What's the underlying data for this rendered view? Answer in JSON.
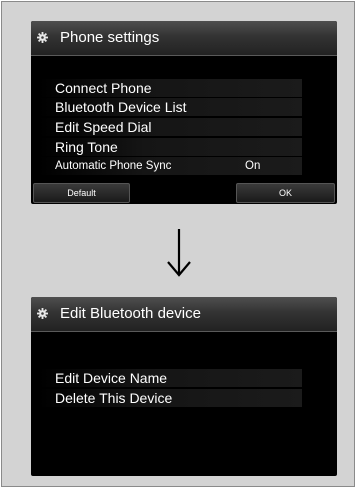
{
  "screen1": {
    "title": "Phone settings",
    "title_icon": "gear-icon",
    "menu": [
      {
        "label": "Connect Phone",
        "value": ""
      },
      {
        "label": "Bluetooth Device List",
        "value": ""
      },
      {
        "label": "Edit Speed Dial",
        "value": ""
      },
      {
        "label": "Ring Tone",
        "value": ""
      },
      {
        "label": "Automatic Phone Sync",
        "value": "On"
      }
    ],
    "buttons": {
      "default": "Default",
      "ok": "OK"
    }
  },
  "transition_icon": "down-arrow-icon",
  "screen2": {
    "title": "Edit Bluetooth device",
    "title_icon": "gear-icon",
    "menu": [
      {
        "label": "Edit Device Name"
      },
      {
        "label": "Delete This Device"
      }
    ]
  },
  "colors": {
    "screen_bg": "#000000",
    "text": "#ffffff",
    "frame_bg": "#d3d3d3"
  }
}
